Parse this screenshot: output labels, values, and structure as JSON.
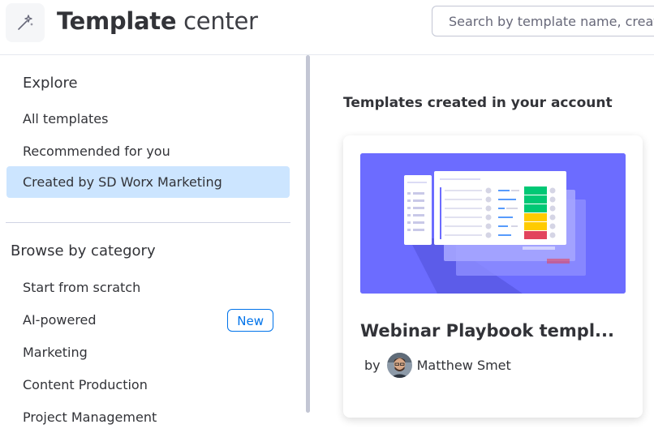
{
  "header": {
    "logo_icon": "magic-wand-icon",
    "title_bold": "Template",
    "title_light": "center",
    "search_placeholder": "Search by template name, creator"
  },
  "sidebar": {
    "explore_title": "Explore",
    "explore_items": [
      {
        "label": "All templates",
        "active": false
      },
      {
        "label": "Recommended for you",
        "active": false
      },
      {
        "label": "Created by SD Worx Marketing",
        "active": true
      }
    ],
    "category_title": "Browse by category",
    "category_items": [
      {
        "label": "Start from scratch"
      },
      {
        "label": "AI-powered",
        "badge": "New"
      },
      {
        "label": "Marketing"
      },
      {
        "label": "Content Production"
      },
      {
        "label": "Project Management"
      }
    ]
  },
  "main": {
    "section_title": "Templates created in your account",
    "card": {
      "title": "Webinar Playbook templ...",
      "by_label": "by",
      "author": "Matthew Smet",
      "thumbnail_icon": "board-preview-icon"
    }
  },
  "colors": {
    "accent": "#0073ea",
    "active_bg": "#cce5ff",
    "thumb_bg": "#6c6cff",
    "status_green": "#00c875",
    "status_yellow": "#ffcb00",
    "status_red": "#e2445c"
  }
}
